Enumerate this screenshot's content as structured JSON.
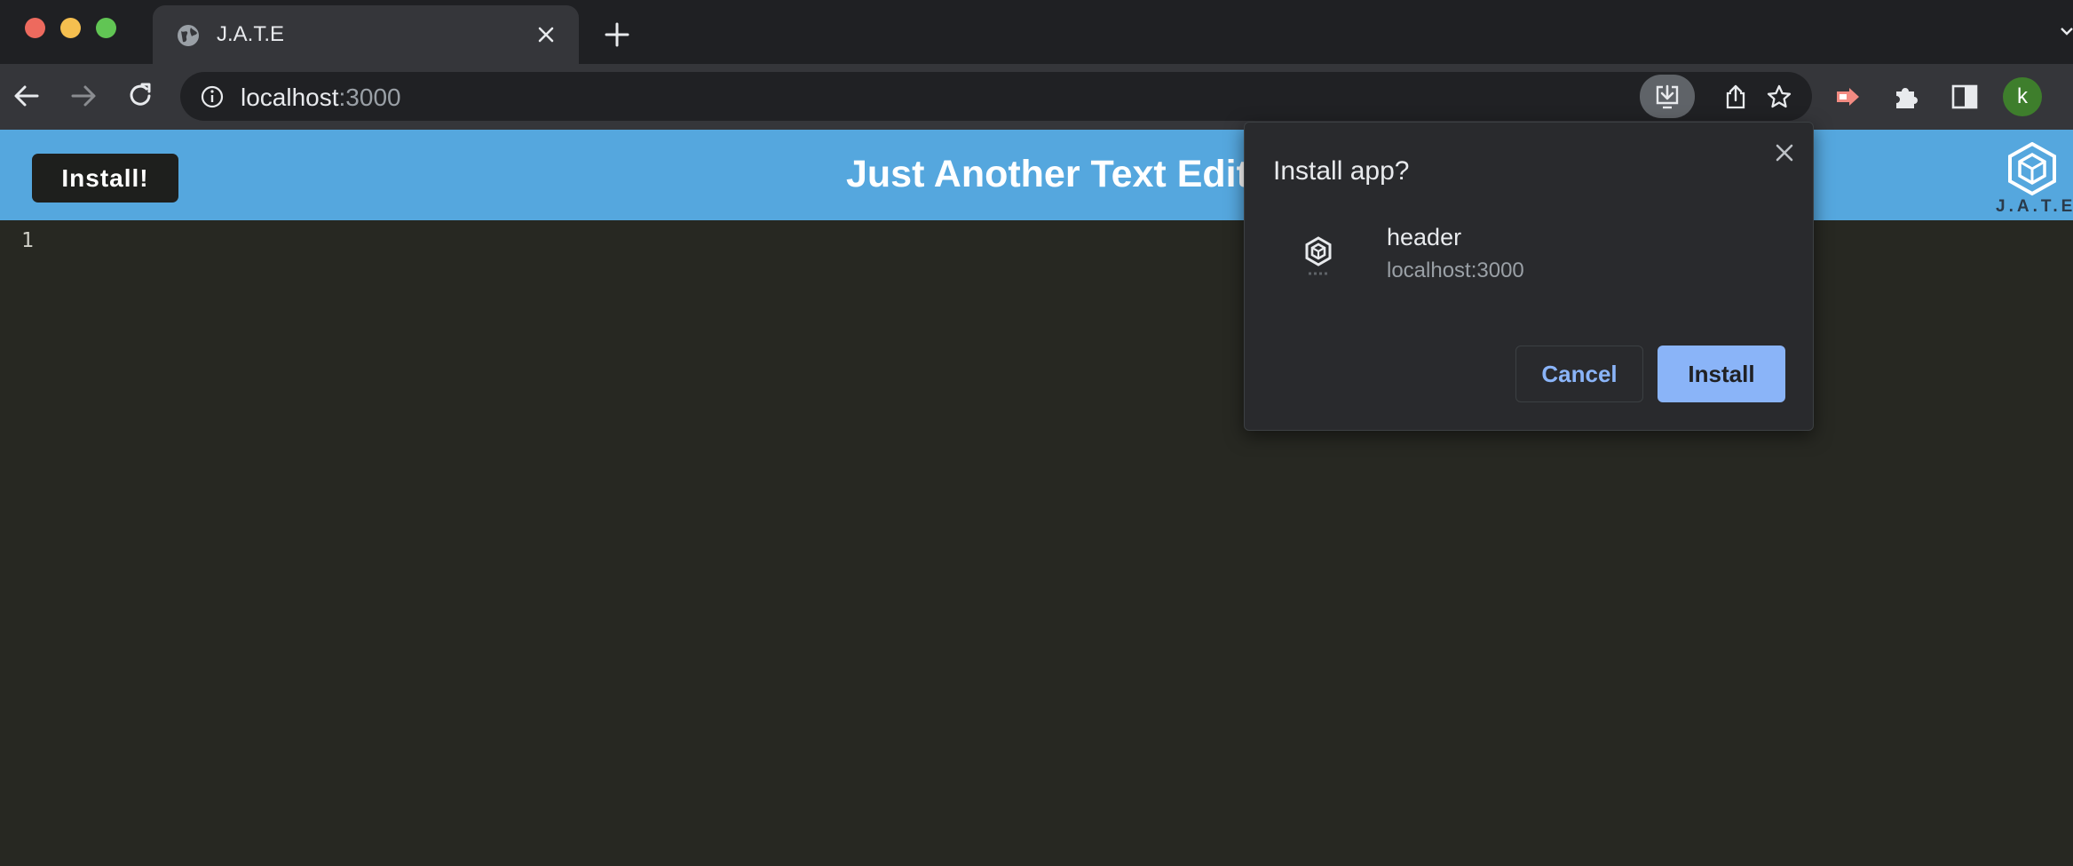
{
  "browser": {
    "tab": {
      "title": "J.A.T.E"
    },
    "address_bar": {
      "host": "localhost",
      "port": ":3000"
    },
    "profile_initial": "k",
    "icons": {
      "back": "back-arrow-icon",
      "forward": "forward-arrow-icon",
      "reload": "reload-icon",
      "site_info": "info-icon",
      "install_app": "install-app-icon",
      "share": "share-icon",
      "bookmark": "star-icon",
      "extension": "extension-icon",
      "extensions_menu": "puzzle-icon",
      "side_panel": "side-panel-icon"
    }
  },
  "page": {
    "install_button": "Install!",
    "title": "Just Another Text Editor",
    "logo_text": "J.A.T.E",
    "editor": {
      "line_numbers": [
        "1"
      ]
    },
    "colors": {
      "header_bg": "#55a7de",
      "editor_bg": "#272822"
    }
  },
  "dialog": {
    "title": "Install app?",
    "app_name": "header",
    "app_origin": "localhost:3000",
    "cancel_label": "Cancel",
    "install_label": "Install",
    "colors": {
      "primary": "#8ab4f8"
    }
  }
}
